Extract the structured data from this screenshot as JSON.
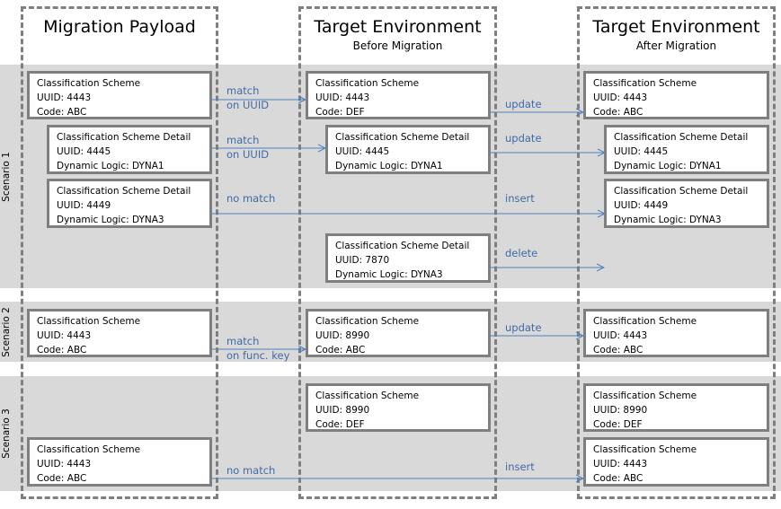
{
  "columns": [
    {
      "title": "Migration Payload",
      "subtitle": ""
    },
    {
      "title": "Target Environment",
      "subtitle": "Before Migration"
    },
    {
      "title": "Target Environment",
      "subtitle": "After Migration"
    }
  ],
  "scenarios": [
    {
      "label": "Scenario 1"
    },
    {
      "label": "Scenario 2"
    },
    {
      "label": "Scenario 3"
    }
  ],
  "boxes": {
    "s1_payload_scheme": [
      "Classification Scheme",
      "UUID: 4443",
      "Code: ABC"
    ],
    "s1_payload_detail1": [
      "Classification Scheme Detail",
      "UUID: 4445",
      "Dynamic Logic: DYNA1"
    ],
    "s1_payload_detail2": [
      "Classification Scheme Detail",
      "UUID: 4449",
      "Dynamic Logic: DYNA3"
    ],
    "s1_before_scheme": [
      "Classification Scheme",
      "UUID: 4443",
      "Code: DEF"
    ],
    "s1_before_detail1": [
      "Classification Scheme Detail",
      "UUID: 4445",
      "Dynamic Logic: DYNA1"
    ],
    "s1_before_detail2": [
      "Classification Scheme Detail",
      "UUID: 7870",
      "Dynamic Logic: DYNA3"
    ],
    "s1_after_scheme": [
      "Classification Scheme",
      "UUID: 4443",
      "Code: ABC"
    ],
    "s1_after_detail1": [
      "Classification Scheme Detail",
      "UUID: 4445",
      "Dynamic Logic: DYNA1"
    ],
    "s1_after_detail2": [
      "Classification Scheme Detail",
      "UUID: 4449",
      "Dynamic Logic: DYNA3"
    ],
    "s2_payload_scheme": [
      "Classification Scheme",
      "UUID: 4443",
      "Code: ABC"
    ],
    "s2_before_scheme": [
      "Classification Scheme",
      "UUID: 8990",
      "Code: ABC"
    ],
    "s2_after_scheme": [
      "Classification Scheme",
      "UUID: 4443",
      "Code: ABC"
    ],
    "s3_before_scheme": [
      "Classification Scheme",
      "UUID: 8990",
      "Code: DEF"
    ],
    "s3_after_scheme1": [
      "Classification Scheme",
      "UUID: 8990",
      "Code: DEF"
    ],
    "s3_payload_scheme": [
      "Classification Scheme",
      "UUID: 4443",
      "Code: ABC"
    ],
    "s3_after_scheme2": [
      "Classification Scheme",
      "UUID: 4443",
      "Code: ABC"
    ]
  },
  "arrow_labels": {
    "s1_match_scheme": [
      "match",
      "on UUID"
    ],
    "s1_match_detail": [
      "match",
      "on UUID"
    ],
    "s1_no_match": [
      "no match"
    ],
    "s1_update_scheme": [
      "update"
    ],
    "s1_update_detail": [
      "update"
    ],
    "s1_insert": [
      "insert"
    ],
    "s1_delete": [
      "delete"
    ],
    "s2_match": [
      "match",
      "on func. key"
    ],
    "s2_update": [
      "update"
    ],
    "s3_no_match": [
      "no match"
    ],
    "s3_insert": [
      "insert"
    ]
  },
  "colors": {
    "band": "#d9d9d9",
    "border": "#7f7f7f",
    "arrow": "#4f81bd",
    "arrow_text": "#3f6aa6"
  }
}
